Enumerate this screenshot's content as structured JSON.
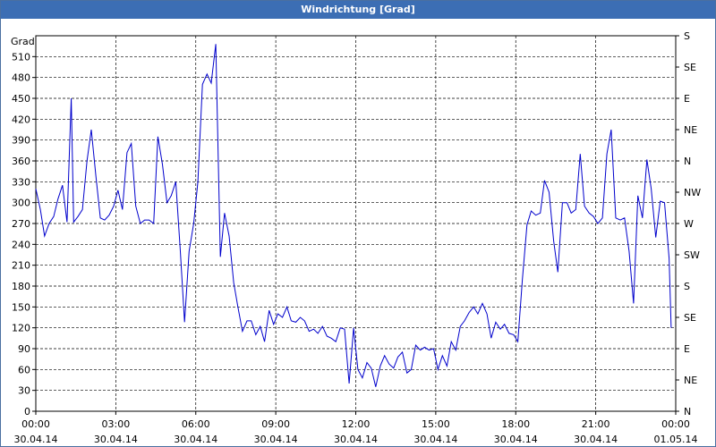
{
  "window": {
    "title": "Windrichtung [Grad]"
  },
  "chart_data": {
    "type": "line",
    "title": "Windrichtung [Grad]",
    "ylabel": "Grad",
    "ylim": [
      0,
      540
    ],
    "yticks": [
      0,
      30,
      60,
      90,
      120,
      150,
      180,
      210,
      240,
      270,
      300,
      330,
      360,
      390,
      420,
      450,
      480,
      510
    ],
    "right_axis_labels": [
      {
        "value": 0,
        "label": "N"
      },
      {
        "value": 45,
        "label": "NE"
      },
      {
        "value": 90,
        "label": "E"
      },
      {
        "value": 135,
        "label": "SE"
      },
      {
        "value": 180,
        "label": "S"
      },
      {
        "value": 225,
        "label": "SW"
      },
      {
        "value": 270,
        "label": "W"
      },
      {
        "value": 315,
        "label": "NW"
      },
      {
        "value": 360,
        "label": "N"
      },
      {
        "value": 405,
        "label": "NE"
      },
      {
        "value": 450,
        "label": "E"
      },
      {
        "value": 495,
        "label": "SE"
      },
      {
        "value": 540,
        "label": "S"
      }
    ],
    "xlim": [
      0,
      24
    ],
    "xticks": [
      {
        "hour": 0,
        "time": "00:00",
        "date": "30.04.14"
      },
      {
        "hour": 3,
        "time": "03:00",
        "date": "30.04.14"
      },
      {
        "hour": 6,
        "time": "06:00",
        "date": "30.04.14"
      },
      {
        "hour": 9,
        "time": "09:00",
        "date": "30.04.14"
      },
      {
        "hour": 12,
        "time": "12:00",
        "date": "30.04.14"
      },
      {
        "hour": 15,
        "time": "15:00",
        "date": "30.04.14"
      },
      {
        "hour": 18,
        "time": "18:00",
        "date": "30.04.14"
      },
      {
        "hour": 21,
        "time": "21:00",
        "date": "30.04.14"
      },
      {
        "hour": 24,
        "time": "00:00",
        "date": "01.05.14"
      }
    ],
    "grid": true,
    "series": [
      {
        "color": "#0000cc",
        "points": [
          [
            0.0,
            320
          ],
          [
            0.17,
            290
          ],
          [
            0.33,
            252
          ],
          [
            0.5,
            270
          ],
          [
            0.67,
            280
          ],
          [
            0.83,
            305
          ],
          [
            1.0,
            325
          ],
          [
            1.17,
            272
          ],
          [
            1.33,
            450
          ],
          [
            1.42,
            272
          ],
          [
            1.58,
            280
          ],
          [
            1.75,
            290
          ],
          [
            1.92,
            360
          ],
          [
            2.08,
            405
          ],
          [
            2.25,
            340
          ],
          [
            2.42,
            278
          ],
          [
            2.58,
            275
          ],
          [
            2.75,
            282
          ],
          [
            2.92,
            295
          ],
          [
            3.08,
            318
          ],
          [
            3.25,
            290
          ],
          [
            3.42,
            372
          ],
          [
            3.58,
            385
          ],
          [
            3.75,
            295
          ],
          [
            3.92,
            270
          ],
          [
            4.08,
            275
          ],
          [
            4.25,
            275
          ],
          [
            4.42,
            270
          ],
          [
            4.58,
            395
          ],
          [
            4.75,
            355
          ],
          [
            4.92,
            300
          ],
          [
            5.08,
            310
          ],
          [
            5.25,
            330
          ],
          [
            5.42,
            230
          ],
          [
            5.58,
            128
          ],
          [
            5.75,
            230
          ],
          [
            5.92,
            270
          ],
          [
            6.08,
            330
          ],
          [
            6.25,
            470
          ],
          [
            6.42,
            485
          ],
          [
            6.58,
            472
          ],
          [
            6.75,
            528
          ],
          [
            6.92,
            222
          ],
          [
            7.08,
            285
          ],
          [
            7.25,
            252
          ],
          [
            7.42,
            185
          ],
          [
            7.58,
            150
          ],
          [
            7.75,
            115
          ],
          [
            7.92,
            130
          ],
          [
            8.08,
            130
          ],
          [
            8.25,
            110
          ],
          [
            8.42,
            122
          ],
          [
            8.58,
            100
          ],
          [
            8.75,
            145
          ],
          [
            8.92,
            125
          ],
          [
            9.08,
            140
          ],
          [
            9.25,
            135
          ],
          [
            9.42,
            150
          ],
          [
            9.58,
            130
          ],
          [
            9.75,
            128
          ],
          [
            9.92,
            135
          ],
          [
            10.08,
            130
          ],
          [
            10.25,
            115
          ],
          [
            10.42,
            118
          ],
          [
            10.58,
            112
          ],
          [
            10.75,
            122
          ],
          [
            10.92,
            108
          ],
          [
            11.08,
            105
          ],
          [
            11.25,
            100
          ],
          [
            11.42,
            120
          ],
          [
            11.58,
            118
          ],
          [
            11.75,
            40
          ],
          [
            11.92,
            120
          ],
          [
            12.08,
            60
          ],
          [
            12.25,
            48
          ],
          [
            12.42,
            70
          ],
          [
            12.58,
            62
          ],
          [
            12.75,
            35
          ],
          [
            12.92,
            65
          ],
          [
            13.08,
            80
          ],
          [
            13.25,
            68
          ],
          [
            13.42,
            62
          ],
          [
            13.58,
            78
          ],
          [
            13.75,
            85
          ],
          [
            13.92,
            55
          ],
          [
            14.08,
            60
          ],
          [
            14.25,
            95
          ],
          [
            14.42,
            88
          ],
          [
            14.58,
            92
          ],
          [
            14.75,
            88
          ],
          [
            14.92,
            90
          ],
          [
            15.08,
            60
          ],
          [
            15.25,
            80
          ],
          [
            15.42,
            65
          ],
          [
            15.58,
            100
          ],
          [
            15.75,
            88
          ],
          [
            15.92,
            122
          ],
          [
            16.08,
            130
          ],
          [
            16.25,
            142
          ],
          [
            16.42,
            150
          ],
          [
            16.58,
            140
          ],
          [
            16.75,
            155
          ],
          [
            16.92,
            140
          ],
          [
            17.08,
            105
          ],
          [
            17.25,
            128
          ],
          [
            17.42,
            118
          ],
          [
            17.58,
            125
          ],
          [
            17.75,
            112
          ],
          [
            17.92,
            110
          ],
          [
            18.08,
            100
          ],
          [
            18.25,
            190
          ],
          [
            18.42,
            268
          ],
          [
            18.58,
            288
          ],
          [
            18.75,
            282
          ],
          [
            18.92,
            285
          ],
          [
            19.08,
            332
          ],
          [
            19.25,
            315
          ],
          [
            19.42,
            245
          ],
          [
            19.58,
            200
          ],
          [
            19.75,
            300
          ],
          [
            19.92,
            300
          ],
          [
            20.08,
            285
          ],
          [
            20.25,
            290
          ],
          [
            20.42,
            370
          ],
          [
            20.58,
            295
          ],
          [
            20.75,
            285
          ],
          [
            20.92,
            280
          ],
          [
            21.08,
            270
          ],
          [
            21.25,
            278
          ],
          [
            21.42,
            370
          ],
          [
            21.58,
            405
          ],
          [
            21.75,
            278
          ],
          [
            21.92,
            275
          ],
          [
            22.08,
            278
          ],
          [
            22.25,
            230
          ],
          [
            22.42,
            155
          ],
          [
            22.58,
            310
          ],
          [
            22.75,
            278
          ],
          [
            22.92,
            362
          ],
          [
            23.08,
            320
          ],
          [
            23.25,
            250
          ],
          [
            23.42,
            302
          ],
          [
            23.58,
            300
          ],
          [
            23.75,
            220
          ],
          [
            23.83,
            120
          ]
        ]
      }
    ]
  }
}
